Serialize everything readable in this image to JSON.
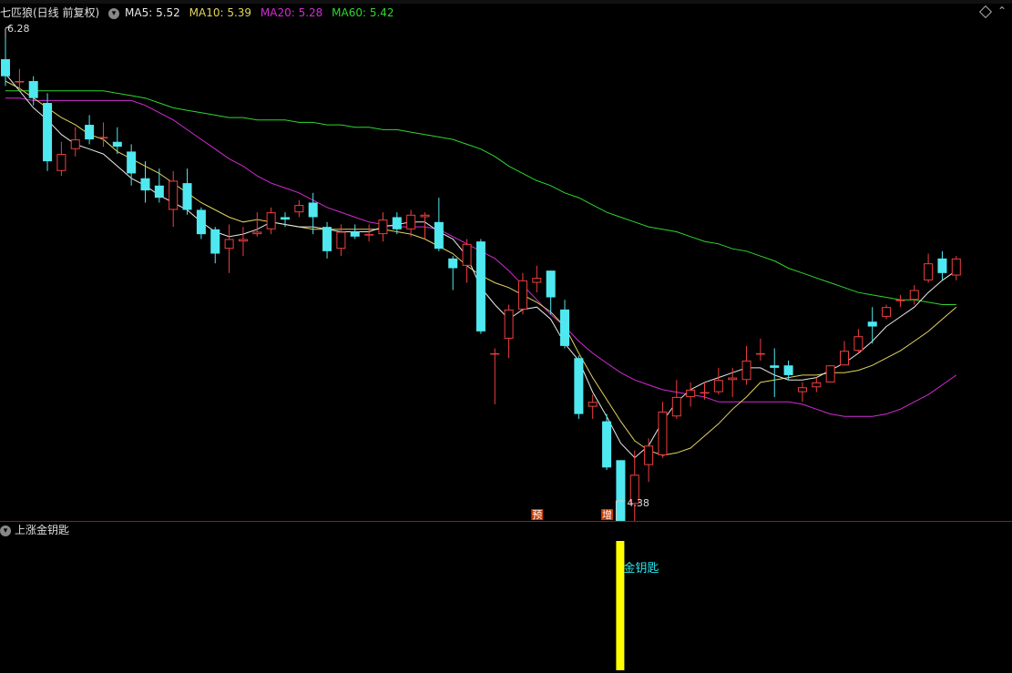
{
  "header": {
    "stock_name": "七匹狼(日线 前复权)",
    "ma5_label": "MA5: 5.52",
    "ma10_label": "MA10: 5.39",
    "ma20_label": "MA20: 5.28",
    "ma60_label": "MA60: 5.42"
  },
  "colors": {
    "up": "#ef3f3f",
    "down": "#4fe8f0",
    "ma5": "#e8e8e8",
    "ma10": "#e3d45d",
    "ma20": "#d42bd4",
    "ma60": "#2fd62f",
    "panel_border": "#8a1d1d",
    "signal_bar": "#ffff00",
    "signal_text": "#29e4ec",
    "marker_yu": "#c43a00",
    "marker_zeng": "#c43a00"
  },
  "chart_data": {
    "type": "candlestick",
    "high_label": "6.28",
    "low_label": "4.38",
    "price_range": [
      4.38,
      6.28
    ],
    "candles": [
      [
        6.19,
        6.12,
        6.28,
        6.08
      ],
      [
        6.1,
        6.1,
        6.15,
        6.06
      ],
      [
        6.1,
        6.03,
        6.12,
        6.0
      ],
      [
        6.01,
        5.77,
        6.05,
        5.73
      ],
      [
        5.73,
        5.8,
        5.85,
        5.71
      ],
      [
        5.82,
        5.86,
        5.91,
        5.79
      ],
      [
        5.92,
        5.86,
        5.96,
        5.84
      ],
      [
        5.87,
        5.87,
        5.93,
        5.83
      ],
      [
        5.85,
        5.83,
        5.91,
        5.8
      ],
      [
        5.81,
        5.72,
        5.84,
        5.67
      ],
      [
        5.7,
        5.65,
        5.77,
        5.6
      ],
      [
        5.67,
        5.62,
        5.74,
        5.6
      ],
      [
        5.57,
        5.69,
        5.73,
        5.5
      ],
      [
        5.68,
        5.57,
        5.74,
        5.55
      ],
      [
        5.57,
        5.47,
        5.58,
        5.45
      ],
      [
        5.49,
        5.39,
        5.5,
        5.35
      ],
      [
        5.41,
        5.45,
        5.51,
        5.31
      ],
      [
        5.44,
        5.45,
        5.5,
        5.38
      ],
      [
        5.47,
        5.48,
        5.56,
        5.46
      ],
      [
        5.49,
        5.56,
        5.58,
        5.47
      ],
      [
        5.54,
        5.53,
        5.56,
        5.5
      ],
      [
        5.56,
        5.59,
        5.61,
        5.54
      ],
      [
        5.6,
        5.54,
        5.64,
        5.47
      ],
      [
        5.5,
        5.4,
        5.52,
        5.37
      ],
      [
        5.41,
        5.48,
        5.51,
        5.38
      ],
      [
        5.48,
        5.46,
        5.51,
        5.45
      ],
      [
        5.47,
        5.47,
        5.51,
        5.44
      ],
      [
        5.47,
        5.53,
        5.56,
        5.44
      ],
      [
        5.54,
        5.49,
        5.56,
        5.47
      ],
      [
        5.49,
        5.55,
        5.57,
        5.46
      ],
      [
        5.54,
        5.55,
        5.56,
        5.45
      ],
      [
        5.52,
        5.41,
        5.62,
        5.4
      ],
      [
        5.37,
        5.33,
        5.38,
        5.24
      ],
      [
        5.34,
        5.43,
        5.45,
        5.27
      ],
      [
        5.44,
        5.07,
        5.45,
        5.06
      ],
      [
        4.98,
        4.98,
        5.0,
        4.77
      ],
      [
        5.04,
        5.16,
        5.18,
        4.96
      ],
      [
        5.16,
        5.28,
        5.31,
        5.14
      ],
      [
        5.27,
        5.29,
        5.34,
        5.23
      ],
      [
        5.32,
        5.21,
        5.32,
        5.14
      ],
      [
        5.16,
        5.01,
        5.2,
        5.0
      ],
      [
        4.96,
        4.73,
        4.97,
        4.71
      ],
      [
        4.76,
        4.78,
        4.81,
        4.71
      ],
      [
        4.7,
        4.51,
        4.73,
        4.5
      ],
      [
        4.54,
        4.27,
        4.54,
        4.14
      ],
      [
        4.36,
        4.48,
        4.58,
        4.22
      ],
      [
        4.52,
        4.6,
        4.63,
        4.45
      ],
      [
        4.56,
        4.74,
        4.78,
        4.55
      ],
      [
        4.72,
        4.8,
        4.87,
        4.71
      ],
      [
        4.8,
        4.83,
        4.86,
        4.76
      ],
      [
        4.82,
        4.82,
        4.86,
        4.79
      ],
      [
        4.82,
        4.87,
        4.92,
        4.81
      ],
      [
        4.87,
        4.88,
        4.92,
        4.8
      ],
      [
        4.87,
        4.95,
        5.01,
        4.85
      ],
      [
        4.98,
        4.98,
        5.04,
        4.95
      ],
      [
        4.93,
        4.92,
        5.0,
        4.8
      ],
      [
        4.93,
        4.89,
        4.95,
        4.87
      ],
      [
        4.82,
        4.84,
        4.86,
        4.78
      ],
      [
        4.84,
        4.86,
        4.88,
        4.82
      ],
      [
        4.86,
        4.93,
        4.93,
        4.86
      ],
      [
        4.93,
        4.99,
        5.03,
        4.93
      ],
      [
        4.99,
        5.05,
        5.08,
        4.98
      ],
      [
        5.11,
        5.09,
        5.17,
        5.02
      ],
      [
        5.13,
        5.17,
        5.18,
        5.12
      ],
      [
        5.2,
        5.2,
        5.22,
        5.17
      ],
      [
        5.2,
        5.24,
        5.26,
        5.18
      ],
      [
        5.28,
        5.35,
        5.39,
        5.27
      ],
      [
        5.37,
        5.31,
        5.4,
        5.28
      ],
      [
        5.3,
        5.37,
        5.38,
        5.28
      ]
    ],
    "ma5": [
      6.13,
      6.06,
      5.99,
      5.94,
      5.88,
      5.84,
      5.82,
      5.8,
      5.75,
      5.7,
      5.67,
      5.63,
      5.6,
      5.57,
      5.52,
      5.48,
      5.46,
      5.47,
      5.49,
      5.52,
      5.51,
      5.5,
      5.5,
      5.49,
      5.48,
      5.48,
      5.48,
      5.5,
      5.51,
      5.52,
      5.52,
      5.48,
      5.45,
      5.38,
      5.25,
      5.18,
      5.12,
      5.16,
      5.17,
      5.12,
      5.02,
      4.95,
      4.82,
      4.72,
      4.61,
      4.55,
      4.6,
      4.7,
      4.78,
      4.83,
      4.86,
      4.88,
      4.9,
      4.92,
      4.92,
      4.89,
      4.87,
      4.87,
      4.88,
      4.91,
      4.94,
      4.98,
      5.03,
      5.09,
      5.13,
      5.17,
      5.23,
      5.28,
      5.32
    ],
    "ma10": [
      6.1,
      6.07,
      6.03,
      5.99,
      5.95,
      5.92,
      5.88,
      5.86,
      5.81,
      5.78,
      5.75,
      5.72,
      5.68,
      5.64,
      5.6,
      5.57,
      5.54,
      5.52,
      5.53,
      5.52,
      5.51,
      5.5,
      5.49,
      5.49,
      5.49,
      5.49,
      5.49,
      5.49,
      5.48,
      5.47,
      5.45,
      5.42,
      5.39,
      5.34,
      5.3,
      5.27,
      5.25,
      5.22,
      5.19,
      5.15,
      5.09,
      4.98,
      4.88,
      4.79,
      4.7,
      4.62,
      4.58,
      4.56,
      4.57,
      4.59,
      4.64,
      4.69,
      4.75,
      4.8,
      4.86,
      4.87,
      4.88,
      4.89,
      4.89,
      4.9,
      4.9,
      4.91,
      4.93,
      4.96,
      4.99,
      5.03,
      5.07,
      5.12,
      5.17
    ],
    "ma20": [
      6.03,
      6.03,
      6.02,
      6.02,
      6.02,
      6.02,
      6.02,
      6.02,
      6.02,
      6.02,
      6.0,
      5.97,
      5.94,
      5.9,
      5.86,
      5.82,
      5.78,
      5.75,
      5.71,
      5.68,
      5.66,
      5.64,
      5.61,
      5.58,
      5.56,
      5.54,
      5.52,
      5.51,
      5.5,
      5.5,
      5.5,
      5.49,
      5.46,
      5.43,
      5.4,
      5.37,
      5.32,
      5.26,
      5.2,
      5.14,
      5.09,
      5.03,
      4.98,
      4.94,
      4.9,
      4.87,
      4.85,
      4.83,
      4.82,
      4.81,
      4.8,
      4.78,
      4.78,
      4.78,
      4.78,
      4.78,
      4.78,
      4.77,
      4.75,
      4.73,
      4.72,
      4.72,
      4.72,
      4.73,
      4.75,
      4.78,
      4.81,
      4.85,
      4.89
    ],
    "ma60": [
      6.06,
      6.06,
      6.06,
      6.06,
      6.06,
      6.06,
      6.06,
      6.06,
      6.05,
      6.04,
      6.03,
      6.01,
      5.99,
      5.98,
      5.97,
      5.96,
      5.95,
      5.95,
      5.94,
      5.94,
      5.94,
      5.93,
      5.93,
      5.92,
      5.92,
      5.91,
      5.91,
      5.9,
      5.9,
      5.89,
      5.88,
      5.87,
      5.86,
      5.84,
      5.82,
      5.79,
      5.75,
      5.72,
      5.69,
      5.67,
      5.64,
      5.62,
      5.59,
      5.56,
      5.54,
      5.52,
      5.5,
      5.49,
      5.48,
      5.46,
      5.44,
      5.43,
      5.41,
      5.4,
      5.38,
      5.36,
      5.33,
      5.31,
      5.29,
      5.27,
      5.25,
      5.23,
      5.22,
      5.21,
      5.2,
      5.2,
      5.19,
      5.18,
      5.18
    ],
    "markers": [
      {
        "index": 38,
        "text": "预"
      },
      {
        "index": 43,
        "text": "增"
      }
    ]
  },
  "subchart": {
    "title": "上涨金钥匙",
    "signal_index": 44,
    "signal_text": "金钥匙",
    "signal_value": 1
  }
}
